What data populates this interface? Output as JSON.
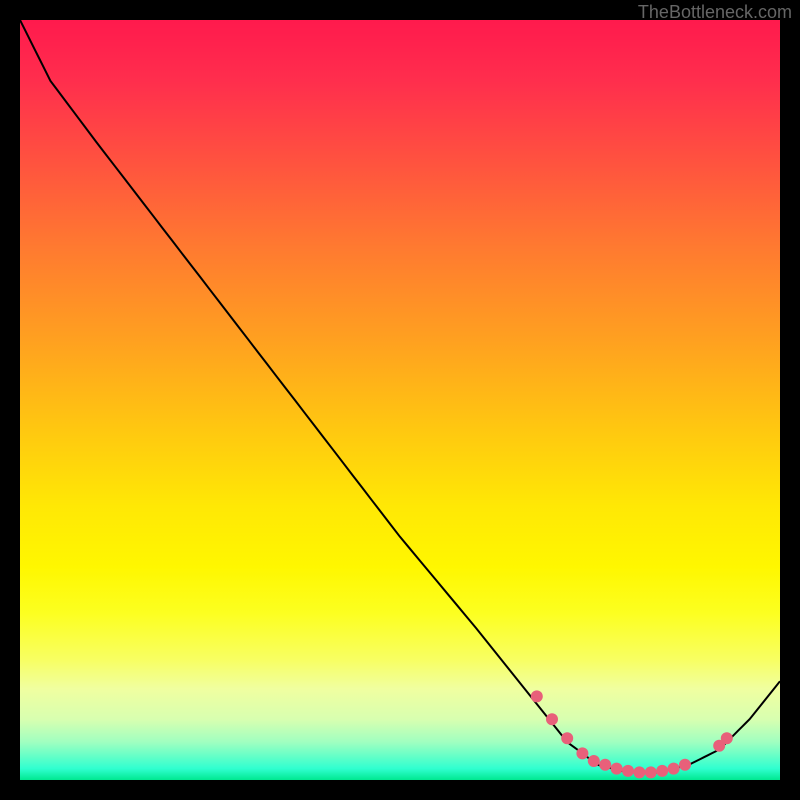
{
  "watermark": "TheBottleneck.com",
  "chart_data": {
    "type": "line",
    "title": "",
    "xlabel": "",
    "ylabel": "",
    "xlim": [
      0,
      100
    ],
    "ylim": [
      0,
      100
    ],
    "curve": {
      "description": "Bottleneck curve descending from top-left, reaching a minimum valley, then rising again",
      "points": [
        {
          "x": 0,
          "y": 100
        },
        {
          "x": 4,
          "y": 92
        },
        {
          "x": 10,
          "y": 84
        },
        {
          "x": 20,
          "y": 71
        },
        {
          "x": 30,
          "y": 58
        },
        {
          "x": 40,
          "y": 45
        },
        {
          "x": 50,
          "y": 32
        },
        {
          "x": 60,
          "y": 20
        },
        {
          "x": 68,
          "y": 10
        },
        {
          "x": 72,
          "y": 5
        },
        {
          "x": 76,
          "y": 2
        },
        {
          "x": 80,
          "y": 1
        },
        {
          "x": 84,
          "y": 1
        },
        {
          "x": 88,
          "y": 2
        },
        {
          "x": 92,
          "y": 4
        },
        {
          "x": 96,
          "y": 8
        },
        {
          "x": 100,
          "y": 13
        }
      ]
    },
    "highlighted_points": [
      {
        "x": 68,
        "y": 11
      },
      {
        "x": 70,
        "y": 8
      },
      {
        "x": 72,
        "y": 5.5
      },
      {
        "x": 74,
        "y": 3.5
      },
      {
        "x": 75.5,
        "y": 2.5
      },
      {
        "x": 77,
        "y": 2
      },
      {
        "x": 78.5,
        "y": 1.5
      },
      {
        "x": 80,
        "y": 1.2
      },
      {
        "x": 81.5,
        "y": 1
      },
      {
        "x": 83,
        "y": 1
      },
      {
        "x": 84.5,
        "y": 1.2
      },
      {
        "x": 86,
        "y": 1.5
      },
      {
        "x": 87.5,
        "y": 2
      },
      {
        "x": 92,
        "y": 4.5
      },
      {
        "x": 93,
        "y": 5.5
      }
    ],
    "gradient_colors": {
      "top": "#ff1a4d",
      "mid_upper": "#ffa020",
      "mid": "#ffe805",
      "mid_lower": "#fcff20",
      "bottom": "#00e890"
    }
  }
}
